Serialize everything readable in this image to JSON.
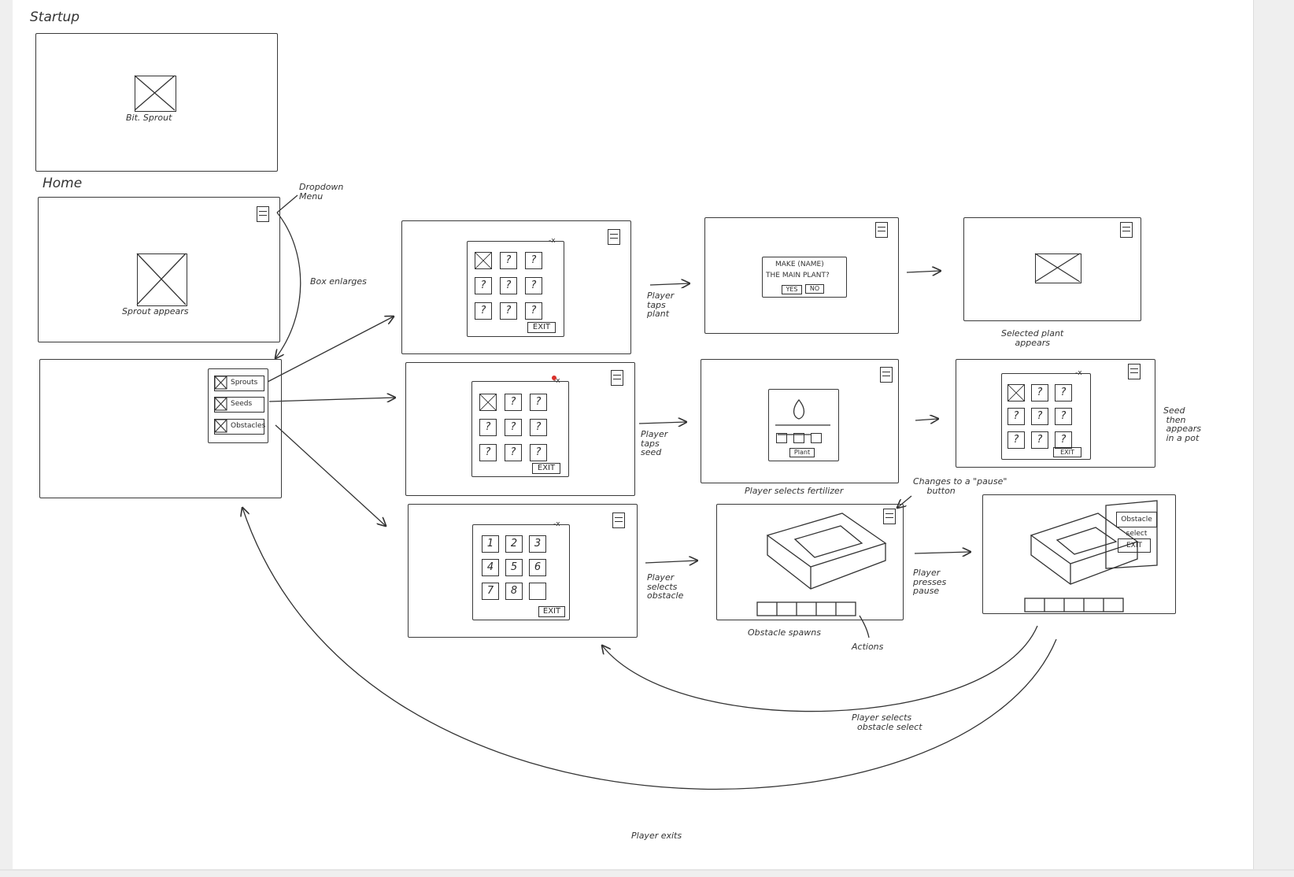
{
  "frames": {
    "startup": {
      "title": "Startup",
      "caption": "Bit. Sprout"
    },
    "home": {
      "title": "Home",
      "caption": "Sprout appears"
    },
    "dropdown": {
      "items": [
        "Sprouts",
        "Seeds",
        "Obstacles"
      ]
    }
  },
  "grids": {
    "sprouts_tiles": [
      "",
      "?",
      "?",
      "?",
      "?",
      "?",
      "?",
      "?",
      "?"
    ],
    "seeds_tiles": [
      "",
      "?",
      "?",
      "?",
      "?",
      "?",
      "?",
      "?",
      "?"
    ],
    "obstacles_tiles": [
      "1",
      "2",
      "3",
      "4",
      "5",
      "6",
      "7",
      "8",
      ""
    ],
    "exit_label": "EXIT",
    "close_label": "-x"
  },
  "dialog": {
    "line1": "MAKE (NAME)",
    "line2": "THE MAIN PLANT?",
    "yes": "YES",
    "no": "NO"
  },
  "fertilizer": {
    "plant_button": "Plant"
  },
  "pause_menu": {
    "obstacle_select": "Obstacle select",
    "exit": "EXIT"
  },
  "annotations": {
    "dropdown_menu": "Dropdown\nMenu",
    "box_enlarges": "Box enlarges",
    "player_taps_plant": "Player\ntaps\nplant",
    "player_taps_seed": "Player\ntaps\nseed",
    "player_selects_obstacle": "Player\nselects\nobstacle",
    "selected_plant_appears": "Selected plant\n     appears",
    "player_selects_fertilizer": "Player selects fertilizer",
    "changes_to_pause": "Changes to a \"pause\"\n     button",
    "seed_appears": "Seed\n then\n appears\n in a pot",
    "obstacle_spawns": "Obstacle spawns",
    "actions": "Actions",
    "player_presses_pause": "Player\npresses\npause",
    "player_selects_obstacle_select": "Player selects\n  obstacle select",
    "player_exits": "Player exits"
  }
}
